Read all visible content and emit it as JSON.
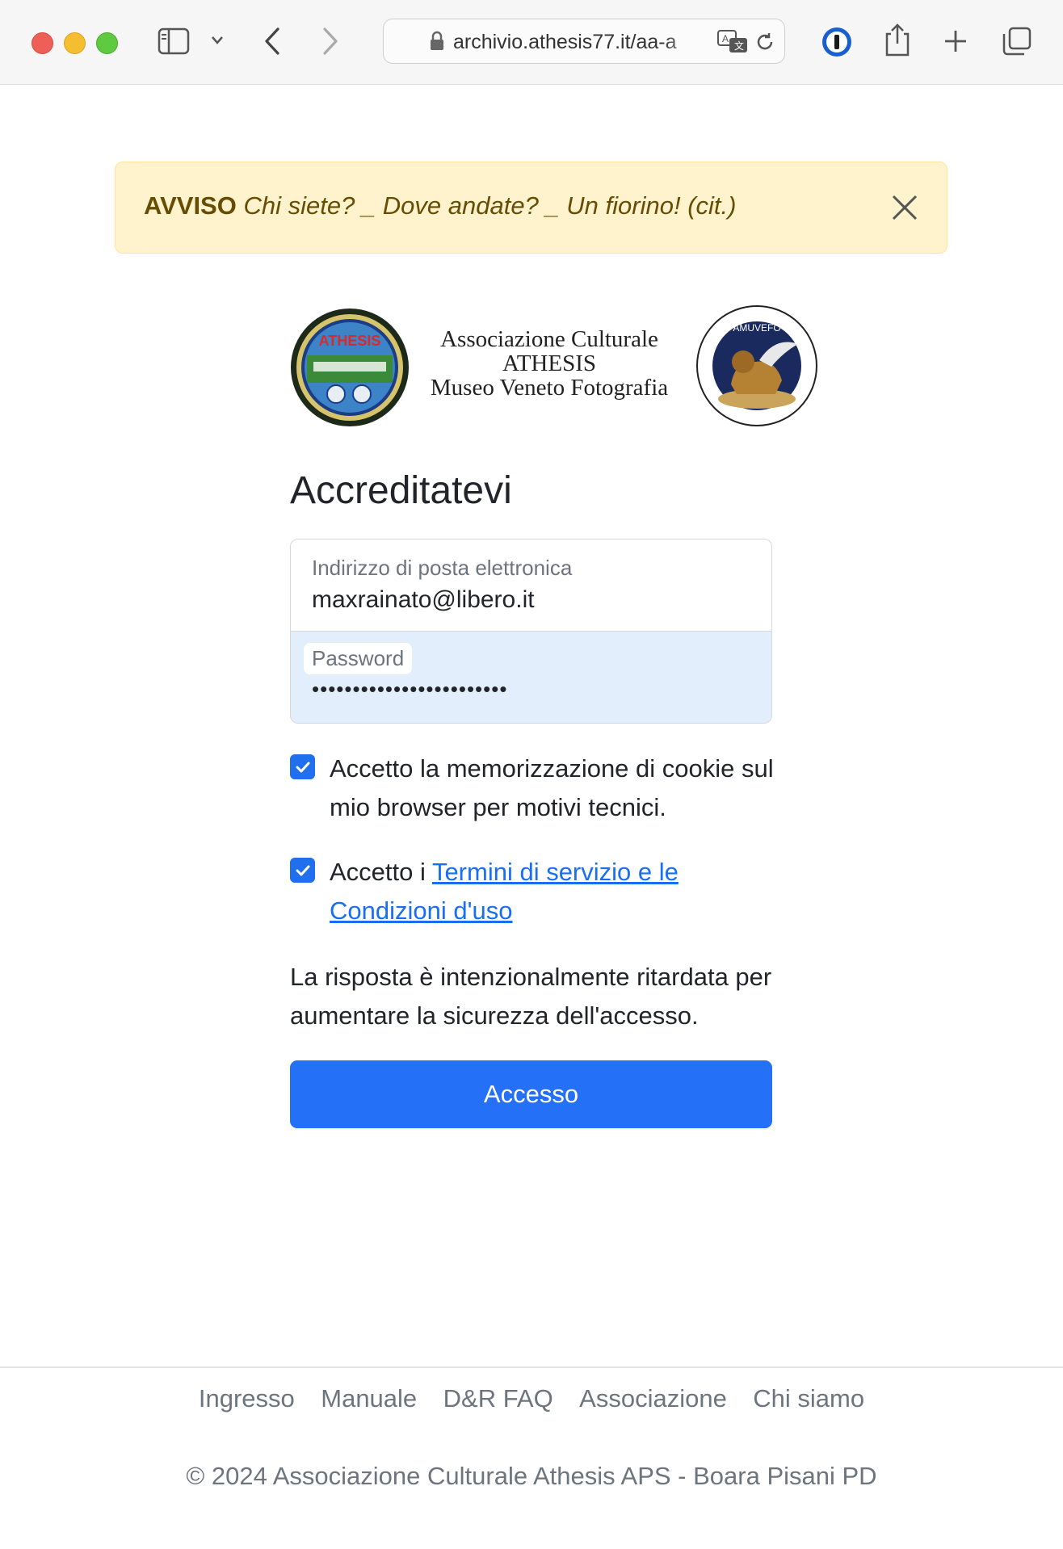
{
  "browser": {
    "url": "archivio.athesis77.it/aa-a",
    "icons": [
      "sidebar-icon",
      "chevron-down-icon",
      "back-icon",
      "forward-icon",
      "lock-icon",
      "translate-icon",
      "reload-icon",
      "password-manager-icon",
      "share-icon",
      "new-tab-icon",
      "tabs-overview-icon"
    ]
  },
  "alert": {
    "label": "AVVISO",
    "message": "Chi siete? _ Dove andate? _ Un fiorino! (cit.)"
  },
  "logo": {
    "line1": "Associazione Culturale",
    "line2": "ATHESIS",
    "line3": "Museo Veneto Fotografia",
    "left_badge_text": "ATHESIS",
    "right_seal_text": "AMUVEFO"
  },
  "form": {
    "title": "Accreditatevi",
    "email_label": "Indirizzo di posta elettronica",
    "email_value": "maxrainato@libero.it",
    "password_label": "Password",
    "password_value": "••••••••••••••••••••••••",
    "cookie_label": "Accetto la memorizzazione di cookie sul mio browser per motivi tecnici.",
    "terms_prefix": "Accetto i ",
    "terms_link": "Termini di servizio e le Condizioni d'uso",
    "note": "La risposta è intenzionalmente ritardata per aumentare la sicurezza dell'accesso.",
    "submit": "Accesso"
  },
  "footer": {
    "links": [
      "Ingresso",
      "Manuale",
      "D&R FAQ",
      "Associazione",
      "Chi siamo"
    ],
    "copyright": "© 2024 Associazione Culturale Athesis APS - Boara Pisani PD"
  },
  "colors": {
    "primary": "#2470f6",
    "alert_bg": "#fff3cd",
    "alert_text": "#664d03",
    "link": "#1a6ef2"
  }
}
